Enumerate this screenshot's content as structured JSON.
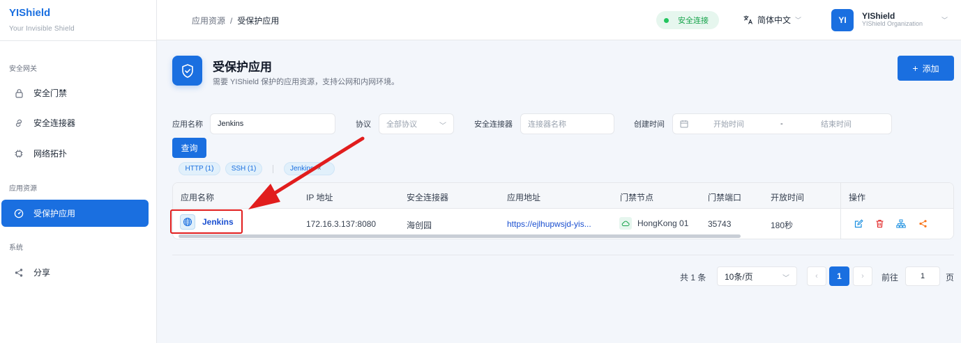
{
  "brand": {
    "name": "YIShield",
    "tagline": "Your Invisible Shield"
  },
  "sidebar": {
    "sections": [
      {
        "title": "安全网关",
        "items": [
          {
            "label": "安全门禁",
            "icon": "lock-icon"
          },
          {
            "label": "安全连接器",
            "icon": "link-icon"
          },
          {
            "label": "网络拓扑",
            "icon": "chip-icon"
          }
        ]
      },
      {
        "title": "应用资源",
        "items": [
          {
            "label": "受保护应用",
            "icon": "gauge-icon",
            "active": true
          }
        ]
      },
      {
        "title": "系统",
        "items": [
          {
            "label": "分享",
            "icon": "share-icon"
          }
        ]
      }
    ]
  },
  "header": {
    "breadcrumb": [
      "应用资源",
      "受保护应用"
    ],
    "breadcrumb_sep": "/",
    "connection_status": "安全连接",
    "language": "简体中文",
    "user": {
      "initials": "YI",
      "name": "YIShield",
      "org": "YIShield Organization"
    }
  },
  "page": {
    "title": "受保护应用",
    "description": "需要 YIShield 保护的应用资源，支持公网和内网环境。",
    "add_label": "添加"
  },
  "filters": {
    "app_name_label": "应用名称",
    "app_name_value": "Jenkins",
    "protocol_label": "协议",
    "protocol_placeholder": "全部协议",
    "connector_label": "安全连接器",
    "connector_placeholder": "连接器名称",
    "created_label": "创建时间",
    "start_placeholder": "开始时间",
    "range_sep": "-",
    "end_placeholder": "结束时间",
    "query_label": "查询",
    "tags": [
      "HTTP (1)",
      "SSH (1)"
    ],
    "active_filter": "Jenkins"
  },
  "table": {
    "columns": [
      "应用名称",
      "IP 地址",
      "安全连接器",
      "应用地址",
      "门禁节点",
      "门禁端口",
      "开放时间",
      "操作"
    ],
    "rows": [
      {
        "name": "Jenkins",
        "ip": "172.16.3.137:8080",
        "connector": "海创园",
        "url": "https://ejlhupwsjd-yis...",
        "node": "HongKong 01",
        "port": "35743",
        "open_time": "180秒"
      }
    ],
    "actions": [
      "edit-icon",
      "delete-icon",
      "topology-icon",
      "share-icon"
    ]
  },
  "pagination": {
    "total": "共 1 条",
    "page_size": "10条/页",
    "current_page": "1",
    "goto_label": "前往",
    "goto_value": "1",
    "page_suffix": "页"
  },
  "colors": {
    "primary": "#1a6fe0",
    "success": "#16a34a",
    "danger": "#e11d1d",
    "accent_orange": "#f97316"
  }
}
